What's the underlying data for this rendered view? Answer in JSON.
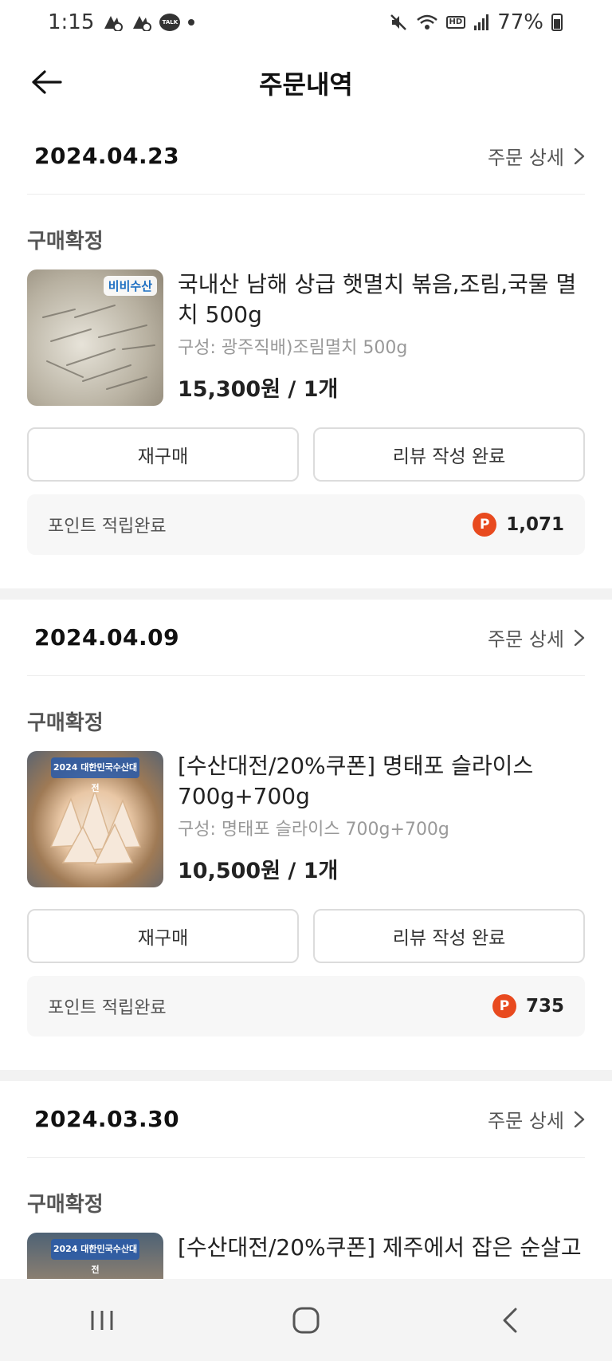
{
  "status_bar": {
    "time": "1:15",
    "battery": "77%",
    "hd_label": "HD",
    "talk_label": "TALK"
  },
  "header": {
    "title": "주문내역",
    "back_icon": "arrow-left-icon"
  },
  "orders": [
    {
      "date": "2024.04.23",
      "detail_label": "주문 상세",
      "status": "구매확정",
      "product_name": "국내산 남해 상급 햇멸치 볶음,조림,국물 멸치 500g",
      "option": "구성: 광주직배)조림멸치 500g",
      "price": "15,300원 / 1개",
      "thumb_brand": "비비수산",
      "rebuy_label": "재구매",
      "review_label": "리뷰 작성 완료",
      "point_label": "포인트 적립완료",
      "point_icon": "P",
      "point_value": "1,071"
    },
    {
      "date": "2024.04.09",
      "detail_label": "주문 상세",
      "status": "구매확정",
      "product_name": "[수산대전/20%쿠폰] 명태포 슬라이스 700g+700g",
      "option": "구성: 명태포 슬라이스 700g+700g",
      "price": "10,500원 / 1개",
      "thumb_brand": "2024 대한민국수산대전",
      "rebuy_label": "재구매",
      "review_label": "리뷰 작성 완료",
      "point_label": "포인트 적립완료",
      "point_icon": "P",
      "point_value": "735"
    },
    {
      "date": "2024.03.30",
      "detail_label": "주문 상세",
      "status": "구매확정",
      "product_name": "[수산대전/20%쿠폰] 제주에서 잡은 순살고",
      "thumb_brand": "2024 대한민국수산대전"
    }
  ],
  "colors": {
    "point_accent": "#e84a1f",
    "divider": "#f2f2f2"
  }
}
